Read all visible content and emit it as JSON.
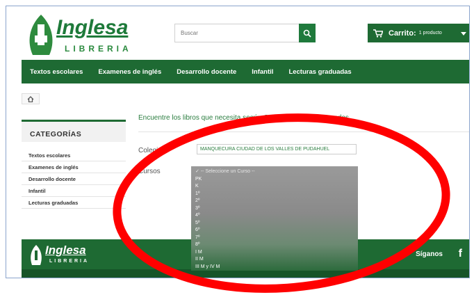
{
  "header": {
    "logo_word": "Inglesa",
    "logo_sub": "LIBRERIA",
    "search_placeholder": "Buscar",
    "cart_label": "Carrito:",
    "cart_count": "1 producto"
  },
  "nav": {
    "items": [
      "Textos escolares",
      "Examenes de inglés",
      "Desarrollo docente",
      "Infantil",
      "Lecturas graduadas"
    ]
  },
  "sidebar": {
    "title": "CATEGORÍAS",
    "items": [
      "Textos escolares",
      "Examenes de inglés",
      "Desarrollo docente",
      "Infantil",
      "Lecturas graduadas"
    ]
  },
  "main": {
    "intro": "Encuentre los libros que necesita según Colegio y Curso ingresados.",
    "colegio_label": "Colegio",
    "colegio_value": "MANQUECURA CIUDAD DE LOS VALLES DE PUDAHUEL",
    "cursos_label": "Cursos"
  },
  "dropdown": {
    "selected": "-- Seleccione un Curso --",
    "options": [
      "PK",
      "K",
      "1º",
      "2º",
      "3º",
      "4º",
      "5º",
      "6º",
      "7º",
      "8º",
      "I M",
      "II M",
      "III M y IV M"
    ]
  },
  "footer": {
    "logo_word": "Inglesa",
    "logo_sub": "LIBRERIA",
    "follow": "Síganos",
    "facebook": "f"
  },
  "colors": {
    "brand_green": "#1e6a33",
    "annotation_red": "#ff0000"
  }
}
